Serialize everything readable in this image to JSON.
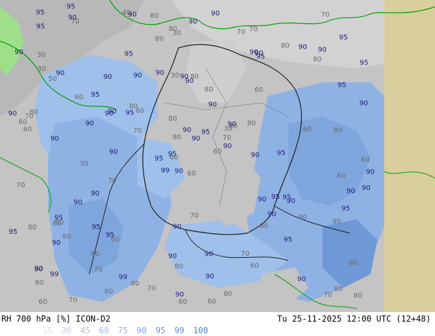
{
  "header": {
    "product": "RH 700 hPa [%] ICON-D2",
    "valid_time": "Tu 25-11-2025 12:00 UTC (12+48)"
  },
  "legend": {
    "levels": [
      {
        "label": "15",
        "color": "#d8dee8"
      },
      {
        "label": "30",
        "color": "#c7d1e0"
      },
      {
        "label": "45",
        "color": "#b5c3d8"
      },
      {
        "label": "60",
        "color": "#9fc0ea"
      },
      {
        "label": "75",
        "color": "#8fb2e4"
      },
      {
        "label": "90",
        "color": "#7fa5dd"
      },
      {
        "label": "95",
        "color": "#6f98d6"
      },
      {
        "label": "99",
        "color": "#5f8bd0"
      },
      {
        "label": "100",
        "color": "#5080c8"
      }
    ]
  },
  "map": {
    "colors": {
      "dry_gray": "#c9c9c9",
      "mid_gray": "#b0b0b0",
      "dark_gray": "#9a9a9a",
      "light_blue": "#9fc0ea",
      "mid_blue": "#7fa5dd",
      "deep_blue": "#5f8bd0",
      "green_dry": "#9ee08a",
      "outside_domain": "#d9cf9c",
      "coast": "#00a000",
      "border": "#1e1e1e",
      "label_gray": "#6a6a6a",
      "label_blue": "#20207a"
    },
    "contour_labels": [
      "60",
      "50",
      "60",
      "80",
      "30",
      "60",
      "70",
      "80",
      "90",
      "60",
      "70",
      "80",
      "90",
      "95",
      "99",
      "60",
      "70",
      "30",
      "90",
      "80",
      "60",
      "80",
      "70",
      "90",
      "30",
      "90",
      "90",
      "30",
      "60",
      "90",
      "90",
      "95",
      "90",
      "80",
      "90",
      "80",
      "95",
      "70",
      "80",
      "95",
      "90",
      "95",
      "90",
      "80",
      "80",
      "90",
      "70",
      "60",
      "80",
      "90",
      "90",
      "95",
      "90",
      "90",
      "60",
      "80",
      "90",
      "95",
      "90",
      "90",
      "90",
      "90",
      "80",
      "95",
      "90",
      "95",
      "70",
      "80",
      "90",
      "95",
      "90",
      "80",
      "95",
      "90",
      "90",
      "95",
      "60",
      "70",
      "80",
      "90",
      "95",
      "99",
      "90",
      "95",
      "90",
      "80",
      "70",
      "90",
      "60",
      "70",
      "80",
      "90",
      "80",
      "95",
      "90",
      "80",
      "70",
      "60",
      "90",
      "95",
      "30",
      "40",
      "60",
      "80",
      "90",
      "95",
      "99",
      "90",
      "80",
      "70",
      "60",
      "30",
      "90",
      "95",
      "90",
      "80",
      "90",
      "95",
      "90",
      "80",
      "60",
      "70",
      "80",
      "90",
      "95",
      "90",
      "80",
      "70",
      "60",
      "30",
      "60",
      "80",
      "90",
      "95",
      "90",
      "80",
      "70",
      "95",
      "90",
      "80"
    ]
  }
}
